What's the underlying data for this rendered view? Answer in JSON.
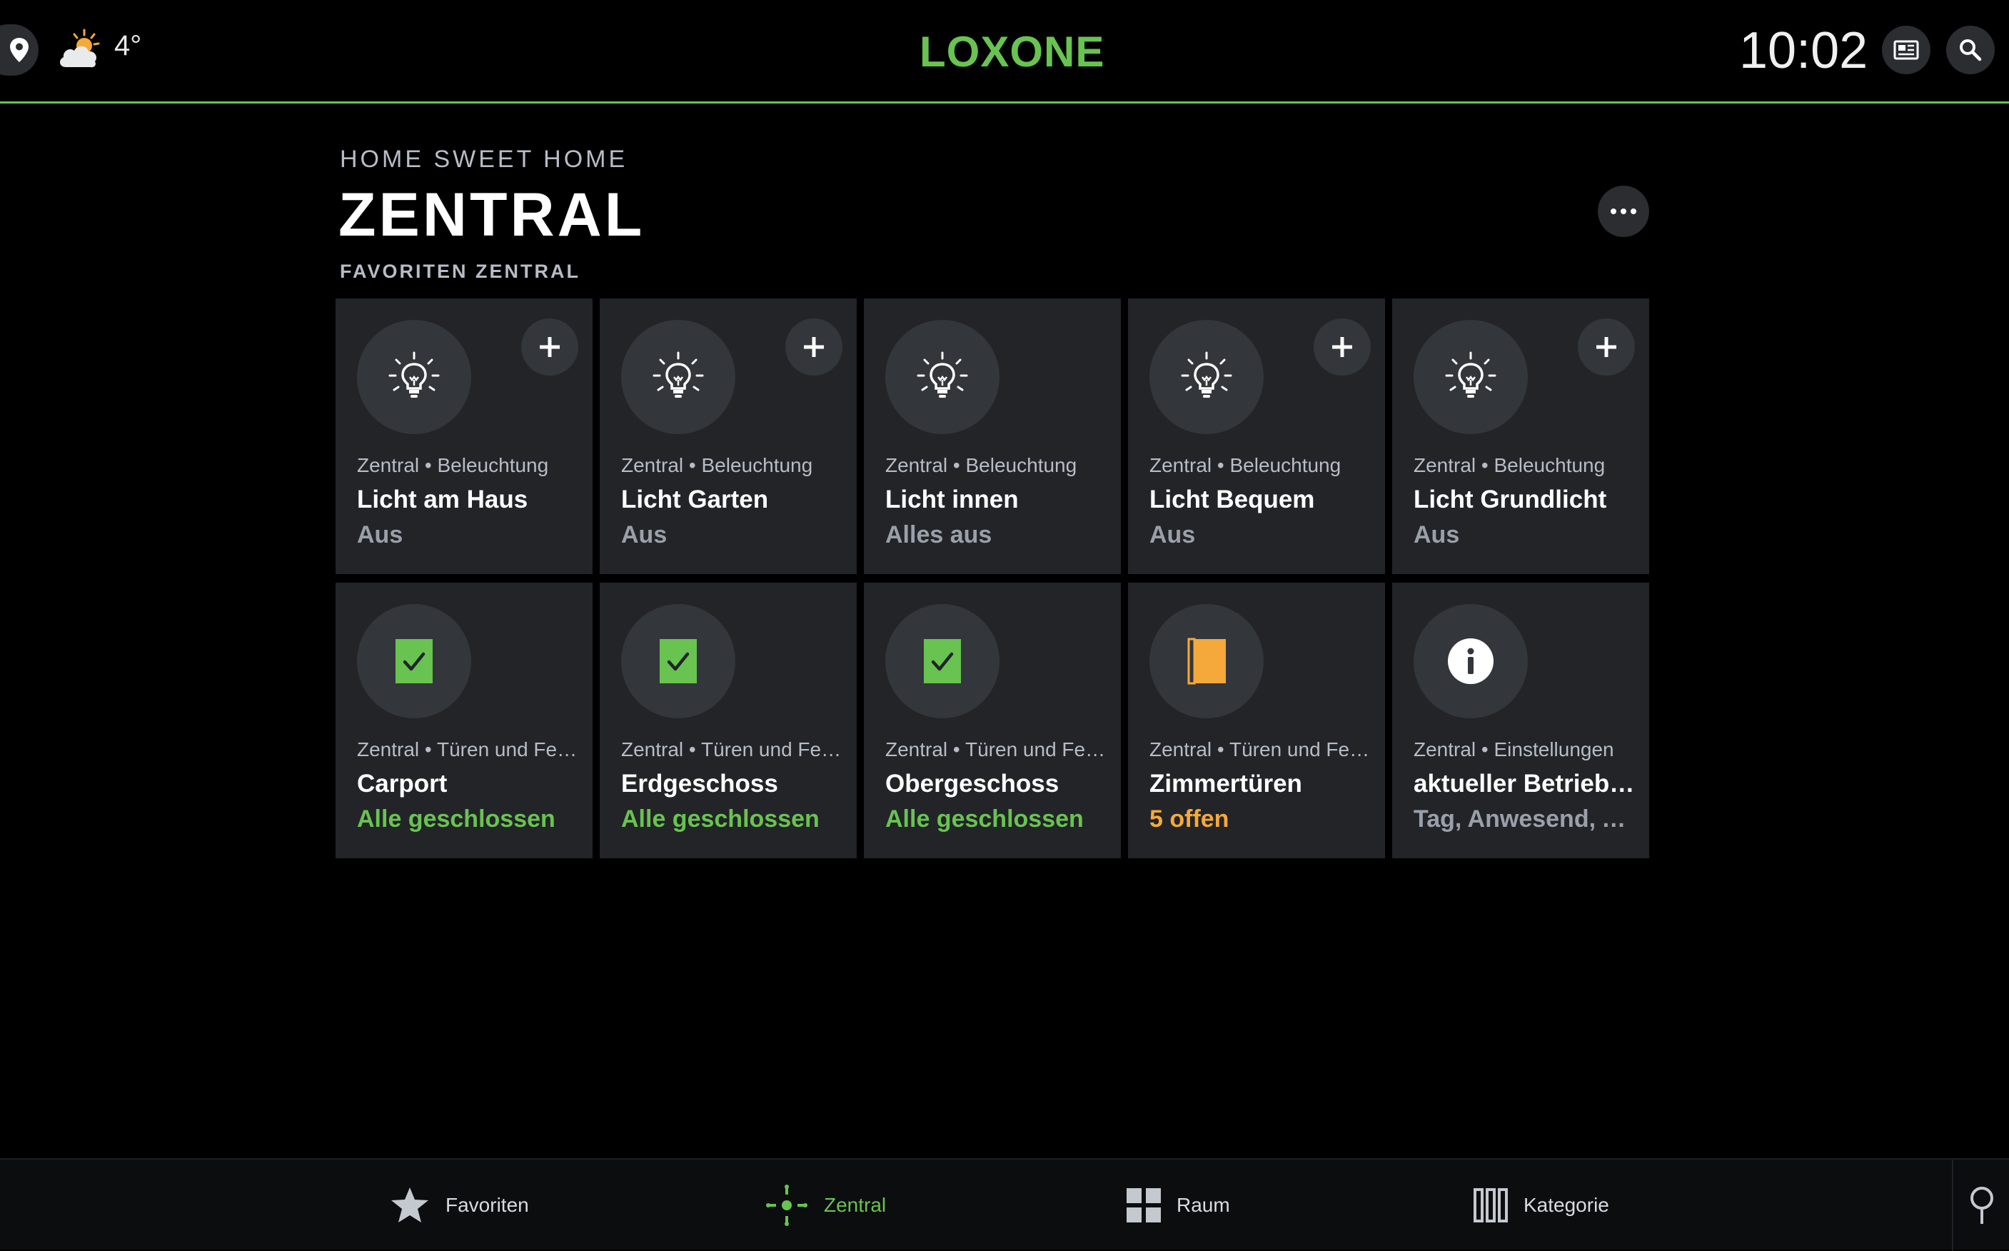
{
  "topbar": {
    "temperature": "4°",
    "logo": "LOXONE",
    "time": "10:02",
    "icons": {
      "location": "location-pin-icon",
      "weather": "partly-cloudy-icon",
      "news": "newspaper-icon",
      "search": "search-icon"
    }
  },
  "header": {
    "home_name": "HOME SWEET HOME",
    "title": "ZENTRAL",
    "section": "FAVORITEN ZENTRAL"
  },
  "colors": {
    "accent_green": "#69c350",
    "state_orange": "#f5a93b",
    "tile_bg": "#222428",
    "icon_circle": "#33363b"
  },
  "tiles": [
    {
      "subtitle": "Zentral • Beleuchtung",
      "name": "Licht am Haus",
      "state": "Aus",
      "icon": "lightbulb-icon",
      "has_add": true,
      "state_color": "grey"
    },
    {
      "subtitle": "Zentral • Beleuchtung",
      "name": "Licht Garten",
      "state": "Aus",
      "icon": "lightbulb-icon",
      "has_add": true,
      "state_color": "grey"
    },
    {
      "subtitle": "Zentral • Beleuchtung",
      "name": "Licht innen",
      "state": "Alles aus",
      "icon": "lightbulb-icon",
      "has_add": false,
      "state_color": "grey"
    },
    {
      "subtitle": "Zentral • Beleuchtung",
      "name": "Licht Bequem",
      "state": "Aus",
      "icon": "lightbulb-icon",
      "has_add": true,
      "state_color": "grey"
    },
    {
      "subtitle": "Zentral • Beleuchtung",
      "name": "Licht Grundlicht",
      "state": "Aus",
      "icon": "lightbulb-icon",
      "has_add": true,
      "state_color": "grey"
    },
    {
      "subtitle": "Zentral • Türen und Fe…",
      "name": "Carport",
      "state": "Alle geschlossen",
      "icon": "check-icon",
      "has_add": false,
      "state_color": "green"
    },
    {
      "subtitle": "Zentral • Türen und Fe…",
      "name": "Erdgeschoss",
      "state": "Alle geschlossen",
      "icon": "check-icon",
      "has_add": false,
      "state_color": "green"
    },
    {
      "subtitle": "Zentral • Türen und Fe…",
      "name": "Obergeschoss",
      "state": "Alle geschlossen",
      "icon": "check-icon",
      "has_add": false,
      "state_color": "green"
    },
    {
      "subtitle": "Zentral • Türen und Fe…",
      "name": "Zimmertüren",
      "state": "5 offen",
      "icon": "open-door-icon",
      "has_add": false,
      "state_color": "orange"
    },
    {
      "subtitle": "Zentral • Einstellungen",
      "name": "aktueller Betriebs…",
      "state": "Tag, Anwesend, A…",
      "icon": "info-icon",
      "has_add": false,
      "state_color": "grey"
    }
  ],
  "nav": {
    "favoriten": "Favoriten",
    "zentral": "Zentral",
    "raum": "Raum",
    "kategorie": "Kategorie",
    "active": "Zentral"
  }
}
